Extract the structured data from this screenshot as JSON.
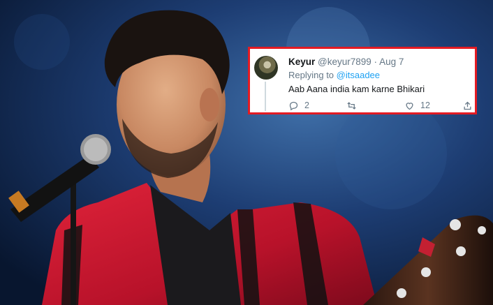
{
  "tweet": {
    "name": "Keyur",
    "handle": "@keyur7899",
    "separator": "·",
    "date": "Aug 7",
    "replying_to_label": "Replying to",
    "replying_to_handle": "@itsaadee",
    "text": "Aab Aana india kam karne Bhikari",
    "reply_count": "2",
    "retweet_count": "",
    "like_count": "12",
    "border_color": "#e31b23",
    "link_color": "#1da1f2"
  },
  "icons": {
    "reply": "reply-icon",
    "retweet": "retweet-icon",
    "like": "heart-icon",
    "share": "share-icon"
  }
}
